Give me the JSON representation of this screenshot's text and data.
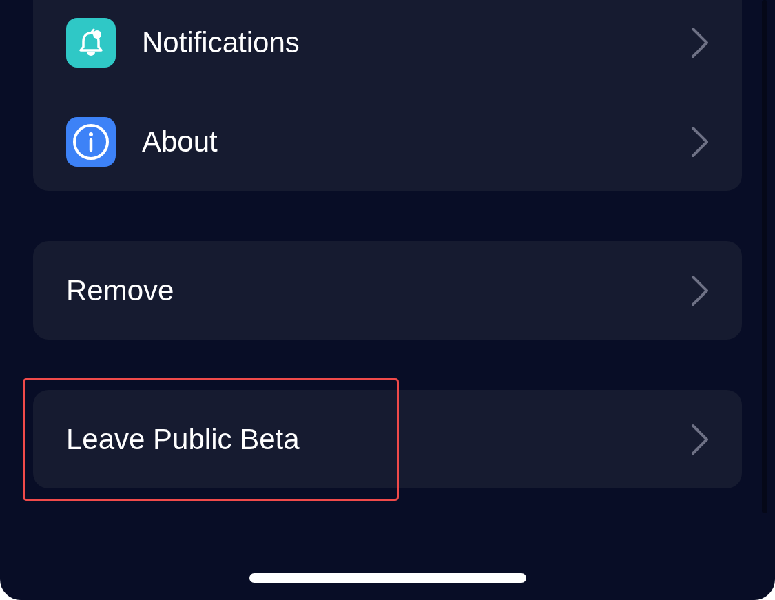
{
  "groups": [
    {
      "highlighted": false,
      "items": [
        {
          "label": "Notifications",
          "kind": "bell",
          "color": "#2fc8c6"
        },
        {
          "label": "About",
          "kind": "info",
          "color": "#3d82f7"
        }
      ]
    },
    {
      "highlighted": false,
      "items": [
        {
          "label": "Remove"
        }
      ]
    },
    {
      "highlighted": true,
      "items": [
        {
          "label": "Leave Public Beta"
        }
      ]
    }
  ]
}
